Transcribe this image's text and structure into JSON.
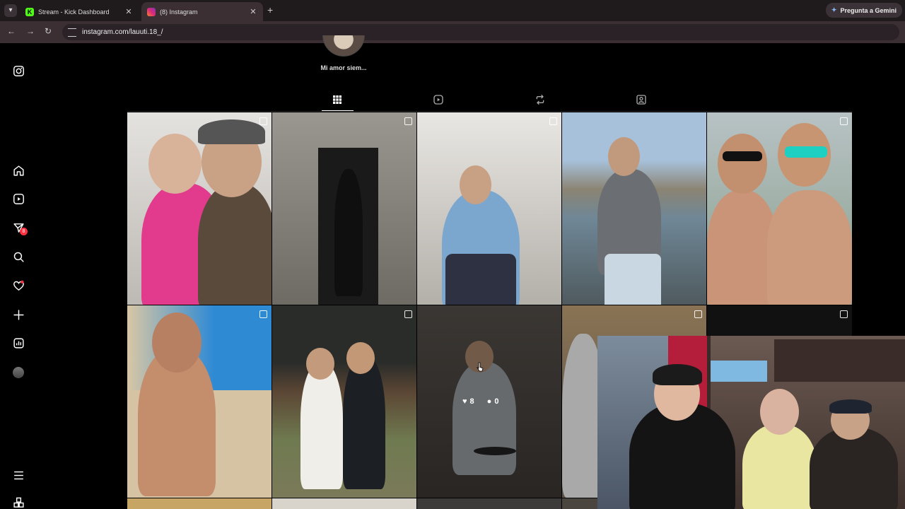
{
  "browser": {
    "tabs": [
      {
        "title": "Stream - Kick Dashboard",
        "active": false,
        "favicon_color": "#53fc18"
      },
      {
        "title": "(8) Instagram",
        "active": true,
        "favicon_color": "#e1306c"
      }
    ],
    "url": "instagram.com/lauuti.18_/",
    "gemini_label": "Pregunta a Gemini"
  },
  "sidebar": {
    "items": [
      {
        "name": "instagram-logo-icon"
      },
      {
        "name": "home-icon"
      },
      {
        "name": "reels-icon"
      },
      {
        "name": "messages-icon",
        "badge": "8"
      },
      {
        "name": "search-icon"
      },
      {
        "name": "notifications-icon"
      },
      {
        "name": "create-icon"
      },
      {
        "name": "dashboard-icon"
      },
      {
        "name": "profile-avatar-icon"
      },
      {
        "name": "more-menu-icon"
      },
      {
        "name": "also-from-meta-icon"
      }
    ]
  },
  "profile": {
    "highlight_label": "Mi amor siem..."
  },
  "tabs": [
    {
      "name": "posts-grid-tab",
      "active": true
    },
    {
      "name": "reels-tab",
      "active": false
    },
    {
      "name": "reposts-tab",
      "active": false
    },
    {
      "name": "tagged-tab",
      "active": false
    }
  ],
  "hovered_post": {
    "likes": "8",
    "comments": "0"
  },
  "colors": {
    "background": "#000000",
    "notification_badge": "#ff3040",
    "browser_chrome": "#3b2f33"
  }
}
